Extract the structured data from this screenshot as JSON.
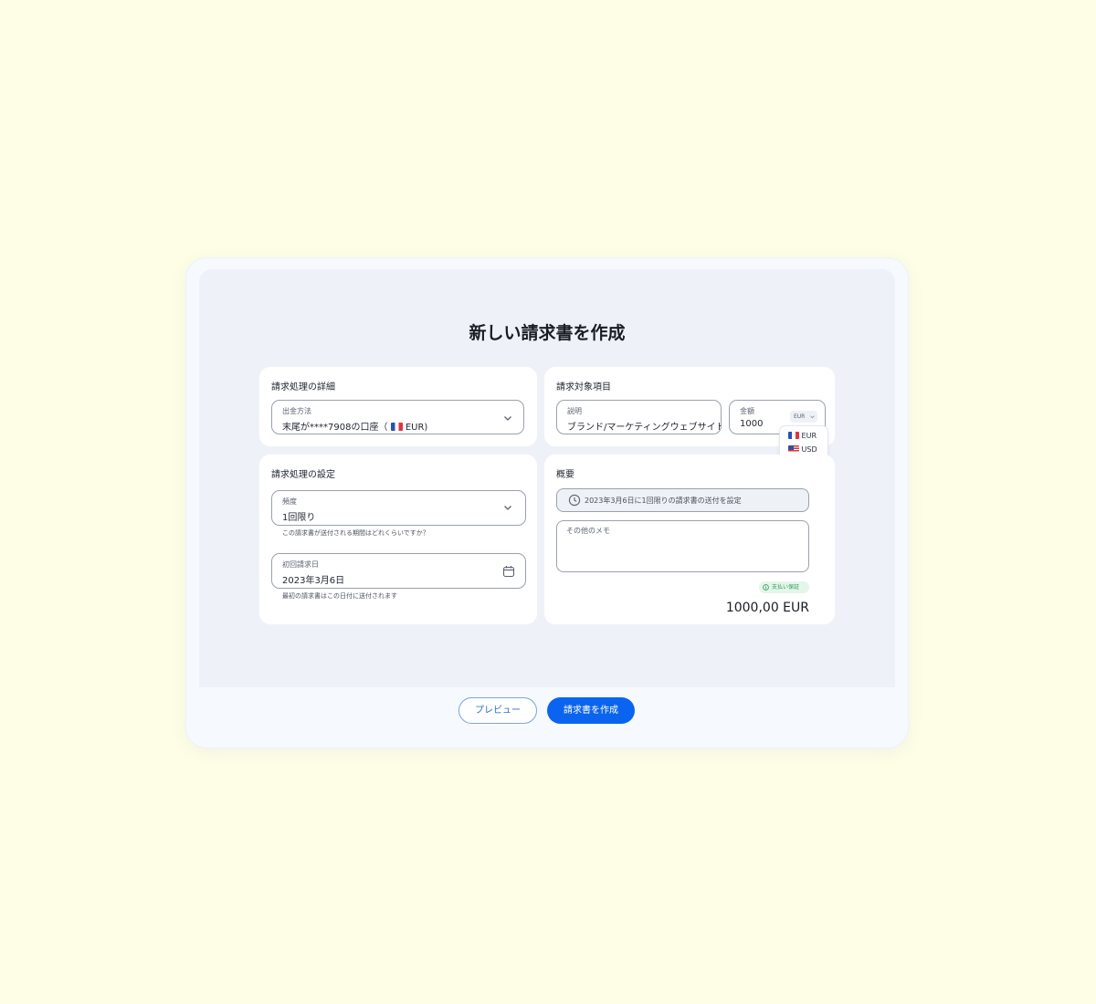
{
  "page_title": "新しい請求書を作成",
  "billing_details": {
    "title": "請求処理の詳細",
    "payout_label": "出金方法",
    "payout_value_prefix": "末尾が****7908の口座（",
    "payout_currency": "EUR)"
  },
  "billing_items": {
    "title": "請求対象項目",
    "description_label": "説明",
    "description_value": "ブランド/マーケティングウェブサイト",
    "amount_label": "金額",
    "amount_value": "1000",
    "currency_selected": "EUR",
    "currency_options": [
      "EUR",
      "USD"
    ]
  },
  "billing_settings": {
    "title": "請求処理の設定",
    "frequency_label": "頻度",
    "frequency_value": "1回限り",
    "frequency_helper": "この請求書が送付される期間はどれくらいですか？",
    "first_date_label": "初回請求日",
    "first_date_value": "2023年3月6日",
    "first_date_helper": "最初の請求書はこの日付に送付されます"
  },
  "summary": {
    "title": "概要",
    "schedule_text": "2023年3月6日に1回限りの請求書の送付を設定",
    "memo_placeholder": "その他のメモ",
    "status_badge": "支払い保証",
    "total": "1000,00 EUR"
  },
  "actions": {
    "preview_label": "プレビュー",
    "create_label": "請求書を作成"
  },
  "colors": {
    "background": "#fefee6",
    "primary": "#0a64f0",
    "badge_green": "#2f9e5b"
  }
}
